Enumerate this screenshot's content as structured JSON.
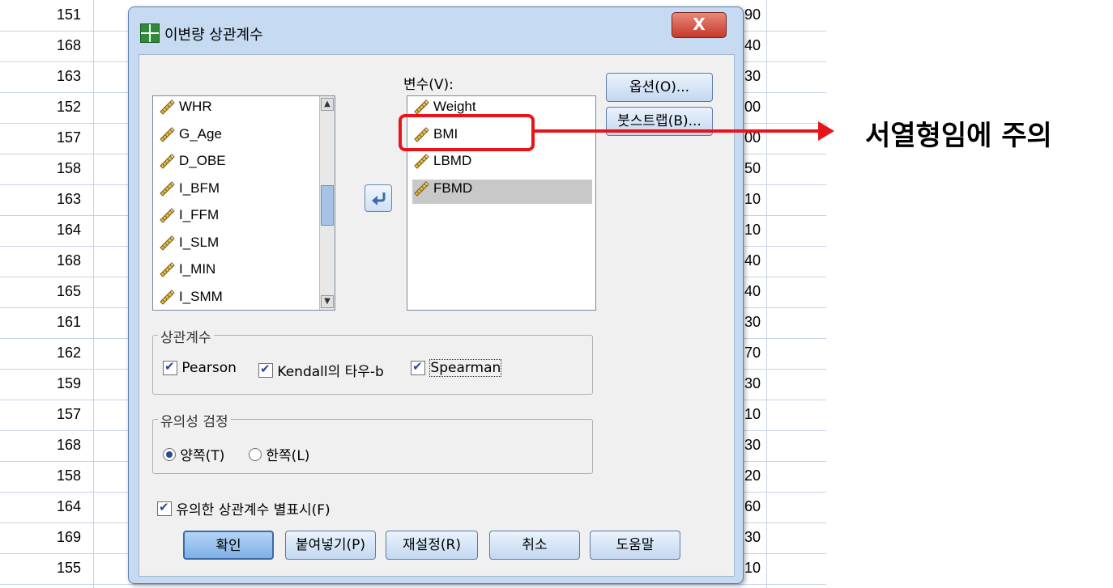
{
  "sheet": {
    "row_numbers": [
      "151",
      "168",
      "163",
      "152",
      "157",
      "158",
      "163",
      "164",
      "168",
      "165",
      "161",
      "162",
      "159",
      "157",
      "168",
      "158",
      "164",
      "169",
      "155"
    ],
    "row_values": [
      ".90",
      ".40",
      ".30",
      ".00",
      ".00",
      ".50",
      ".10",
      ".10",
      ".40",
      ".40",
      ".30",
      ".70",
      ".30",
      ".10",
      ".30",
      ".20",
      ".60",
      ".30",
      ".10"
    ]
  },
  "dialog": {
    "title": "이변량 상관계수",
    "close_label": "X",
    "left_list": [
      "WHR",
      "G_Age",
      "D_OBE",
      "I_BFM",
      "I_FFM",
      "I_SLM",
      "I_MIN",
      "I_SMM"
    ],
    "variables_label": "변수(V):",
    "right_list": [
      "Weight",
      "BMI",
      "LBMD",
      "FBMD"
    ],
    "options_button": "옵션(O)...",
    "bootstrap_button": "붓스트랩(B)...",
    "correlation_group": {
      "title": "상관계수",
      "pearson": "Pearson",
      "kendall": "Kendall의 타우-b",
      "spearman": "Spearman"
    },
    "significance_group": {
      "title": "유의성 검정",
      "two_tailed": "양쪽(T)",
      "one_tailed": "한쪽(L)"
    },
    "flag_label": "유의한 상관계수 별표시(F)",
    "buttons": {
      "ok": "확인",
      "paste": "붙여넣기(P)",
      "reset": "재설정(R)",
      "cancel": "취소",
      "help": "도움말"
    }
  },
  "annotation": {
    "note": "서열형임에 주의",
    "color": "#e8141a"
  }
}
